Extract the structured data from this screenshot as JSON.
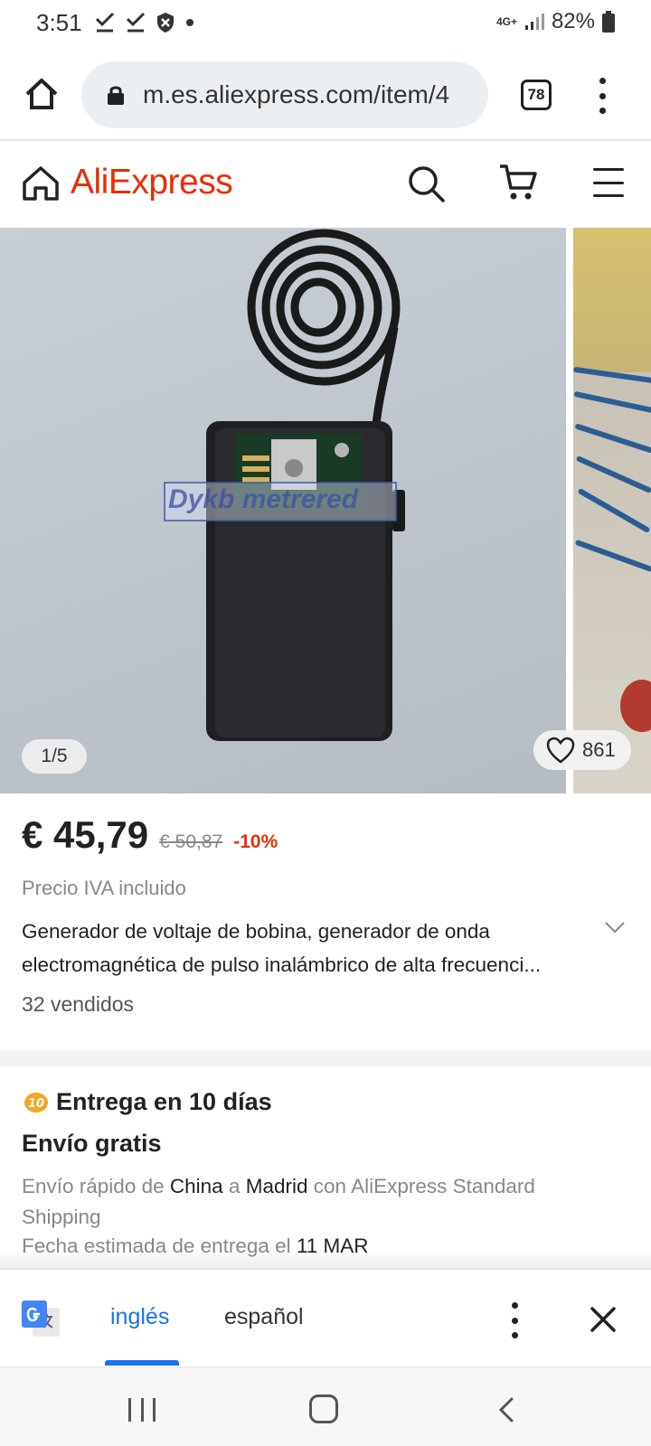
{
  "status_bar": {
    "time": "3:51",
    "network": "4G+",
    "battery": "82%"
  },
  "browser": {
    "url": "m.es.aliexpress.com/item/4",
    "tab_count": "78"
  },
  "header": {
    "logo": "AliExpress"
  },
  "gallery": {
    "counter": "1/5",
    "wishlist_count": "861",
    "watermark": "Dykb metrered"
  },
  "product": {
    "price": "€ 45,79",
    "original_price": "€ 50,87",
    "discount": "-10%",
    "vat_note": "Precio IVA incluido",
    "title": "Generador de voltaje de bobina, generador de onda electromagnética de pulso inalámbrico de alta frecuenci...",
    "sold": "32 vendidos"
  },
  "delivery": {
    "badge": "10",
    "title": "Entrega en 10 días",
    "free_shipping": "Envío gratis",
    "fast_label": "Envío rápido de",
    "from": "China",
    "to_word": "a",
    "to": "Madrid",
    "with_word": "con",
    "carrier": "AliExpress Standard Shipping",
    "estimate_label": "Fecha estimada de entrega el",
    "estimate_date": "11 MAR"
  },
  "translate": {
    "lang_active": "inglés",
    "lang_other": "español"
  },
  "colors": {
    "brand": "#e62e04",
    "translate_accent": "#1a73e8"
  }
}
